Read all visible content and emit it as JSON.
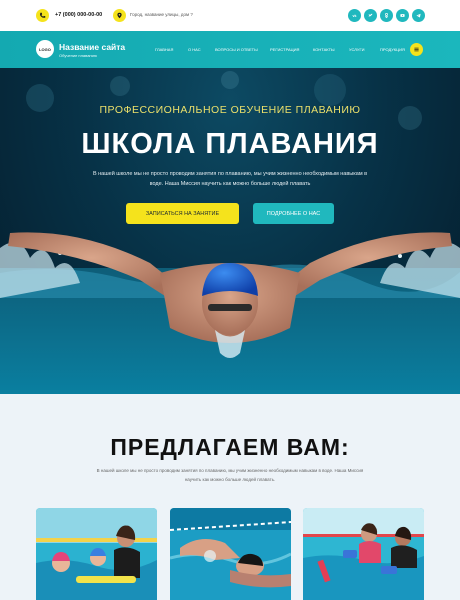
{
  "topbar": {
    "phone": "+7 (000) 000-00-00",
    "address": "Город, название улицы, дом ?",
    "social_icons": [
      "vk-icon",
      "twitter-icon",
      "odnoklassniki-icon",
      "youtube-icon",
      "telegram-icon"
    ]
  },
  "header": {
    "logo_text": "LOGO",
    "site_title": "Название сайта",
    "site_subtitle": "Обучение плаванию",
    "menu": [
      "Главная",
      "О нас",
      "Вопросы и ответы",
      "Регистрация",
      "Контакты",
      "Услуги",
      "Продукция"
    ]
  },
  "hero": {
    "kicker": "ПРОФЕССИОНАЛЬНОЕ ОБУЧЕНИЕ ПЛАВАНИЮ",
    "title": "ШКОЛА ПЛАВАНИЯ",
    "description": "В нашей школе мы не просто проводим занятия по плаванию, мы учим жизненно необходимым навыкам в воде. Наша Миссия научить как можно больше людей плавать",
    "primary_button": "ЗАПИСАТЬСЯ НА ЗАНЯТИЕ",
    "secondary_button": "ПОДРОБНЕЕ О НАС"
  },
  "offer": {
    "title": "ПРЕДЛАГАЕМ ВАМ:",
    "description": "В нашей школе мы не просто проводим занятия по плаванию, мы учим жизненно необходимым навыкам в воде. Наша Миссия научить как можно больше людей плавать."
  },
  "colors": {
    "accent_yellow": "#f5e31c",
    "accent_teal": "#20b8be",
    "hero_bg": "#073247",
    "section_bg": "#edf3f8"
  }
}
